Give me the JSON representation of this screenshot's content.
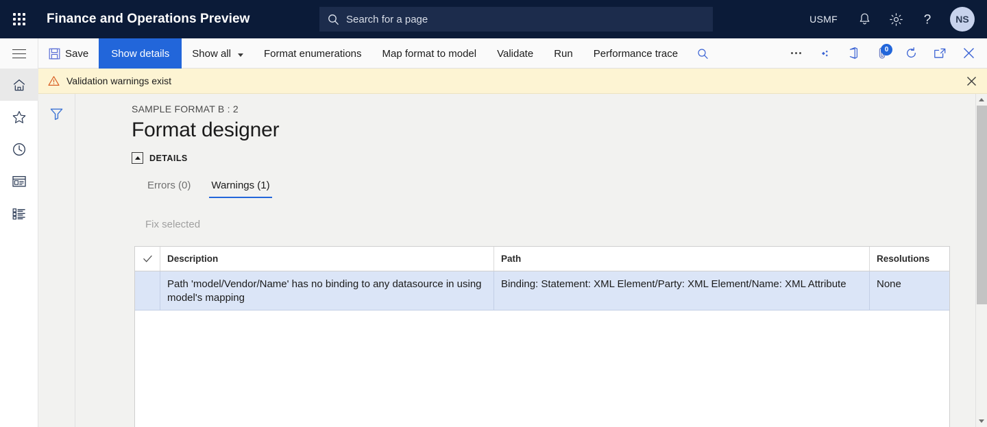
{
  "topbar": {
    "waffle_label": "app-launcher",
    "app_title": "Finance and Operations Preview",
    "search_placeholder": "Search for a page",
    "company": "USMF",
    "icons": [
      "notifications-icon",
      "settings-icon",
      "help-icon"
    ],
    "avatar_initials": "NS"
  },
  "commandbar": {
    "nav_toggle": "show-hide-navigation",
    "buttons": [
      {
        "label": "Save",
        "icon": "save-icon",
        "style": "default"
      },
      {
        "label": "Show details",
        "icon": "",
        "style": "primary"
      },
      {
        "label": "Show all",
        "icon": "",
        "style": "dropdown"
      },
      {
        "label": "Format enumerations",
        "icon": "",
        "style": "default"
      },
      {
        "label": "Map format to model",
        "icon": "",
        "style": "default"
      },
      {
        "label": "Validate",
        "icon": "",
        "style": "default"
      },
      {
        "label": "Run",
        "icon": "",
        "style": "default"
      },
      {
        "label": "Performance trace",
        "icon": "",
        "style": "default"
      }
    ],
    "search_icon": "search-icon",
    "right_icons": [
      "overflow-menu-icon",
      "share-icon",
      "open-in-office-icon",
      "attachments-icon",
      "refresh-icon",
      "open-in-new-window-icon",
      "close-icon"
    ],
    "attachments_count": "0"
  },
  "rail": {
    "items": [
      {
        "name": "home",
        "icon": "home-icon",
        "active": true
      },
      {
        "name": "favorites",
        "icon": "star-icon",
        "active": false
      },
      {
        "name": "recent",
        "icon": "clock-icon",
        "active": false
      },
      {
        "name": "workspaces",
        "icon": "workspace-icon",
        "active": false
      },
      {
        "name": "modules",
        "icon": "modules-list-icon",
        "active": false
      }
    ]
  },
  "filter_pane": {
    "icon": "filter-funnel-icon"
  },
  "notification": {
    "icon": "warning-triangle-icon",
    "text": "Validation warnings exist",
    "close_icon": "close-icon",
    "bg_color": "#fdf4d3"
  },
  "page": {
    "breadcrumb": "SAMPLE FORMAT B : 2",
    "title": "Format designer",
    "details_section_label": "DETAILS",
    "collapse_icon": "collapse-triangle-icon"
  },
  "tabs": [
    {
      "label": "Errors (0)",
      "active": false
    },
    {
      "label": "Warnings (1)",
      "active": true
    }
  ],
  "actions": {
    "fix_selected_label": "Fix selected",
    "fix_selected_disabled": true
  },
  "grid": {
    "columns": [
      {
        "key": "check",
        "label": "",
        "icon": "checkmark-icon"
      },
      {
        "key": "description",
        "label": "Description"
      },
      {
        "key": "path",
        "label": "Path"
      },
      {
        "key": "resolutions",
        "label": "Resolutions"
      }
    ],
    "rows": [
      {
        "selected": true,
        "description": "Path 'model/Vendor/Name' has no binding to any datasource in using model's mapping",
        "path": "Binding: Statement: XML Element/Party: XML Element/Name: XML Attribute",
        "resolutions": "None"
      }
    ]
  },
  "scrollbar": {
    "up_icon": "scroll-up-arrow",
    "down_icon": "scroll-down-arrow"
  },
  "colors": {
    "nav_bg": "#0b1b38",
    "accent": "#2266da",
    "row_selected": "#dbe5f7",
    "warning_bg": "#fdf4d3",
    "page_bg": "#f2f2f0"
  }
}
